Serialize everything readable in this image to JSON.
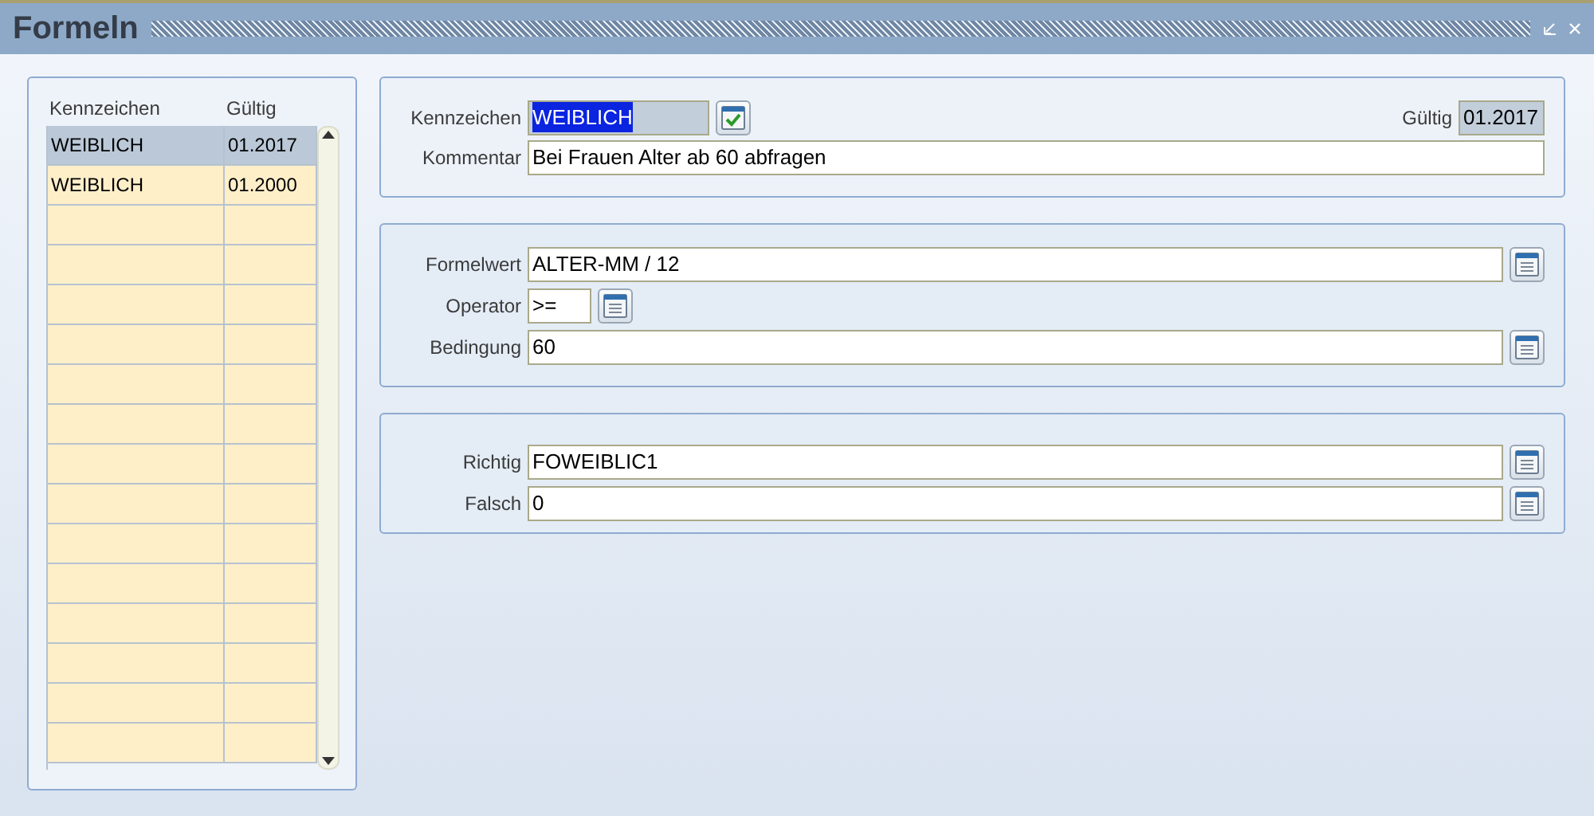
{
  "window": {
    "title": "Formeln"
  },
  "list": {
    "columns": [
      "Kennzeichen",
      "Gültig"
    ],
    "rows": [
      {
        "cells": [
          "WEIBLICH",
          "01.2017"
        ],
        "selected": true
      },
      {
        "cells": [
          "WEIBLICH",
          "01.2000"
        ],
        "selected": false
      }
    ]
  },
  "header": {
    "kennzeichen": {
      "label": "Kennzeichen",
      "value": "WEIBLICH",
      "readonly": true,
      "text_selected": true,
      "kind": "validate"
    },
    "gueltig": {
      "label": "Gültig",
      "value": "01.2017",
      "readonly": true
    },
    "kommentar": {
      "label": "Kommentar",
      "value": "Bei Frauen Alter ab 60 abfragen",
      "readonly": false
    }
  },
  "sections": [
    [
      {
        "label": "Formelwert",
        "value": "ALTER-MM / 12",
        "kind": "lookup"
      },
      {
        "label": "Operator",
        "value": ">=",
        "kind": "compact"
      },
      {
        "label": "Bedingung",
        "value": "60",
        "kind": "lookup"
      }
    ],
    [
      {
        "label": "Richtig",
        "value": "FOWEIBLIC1",
        "kind": "lookup"
      },
      {
        "label": "Falsch",
        "value": "0",
        "kind": "lookup"
      }
    ]
  ]
}
